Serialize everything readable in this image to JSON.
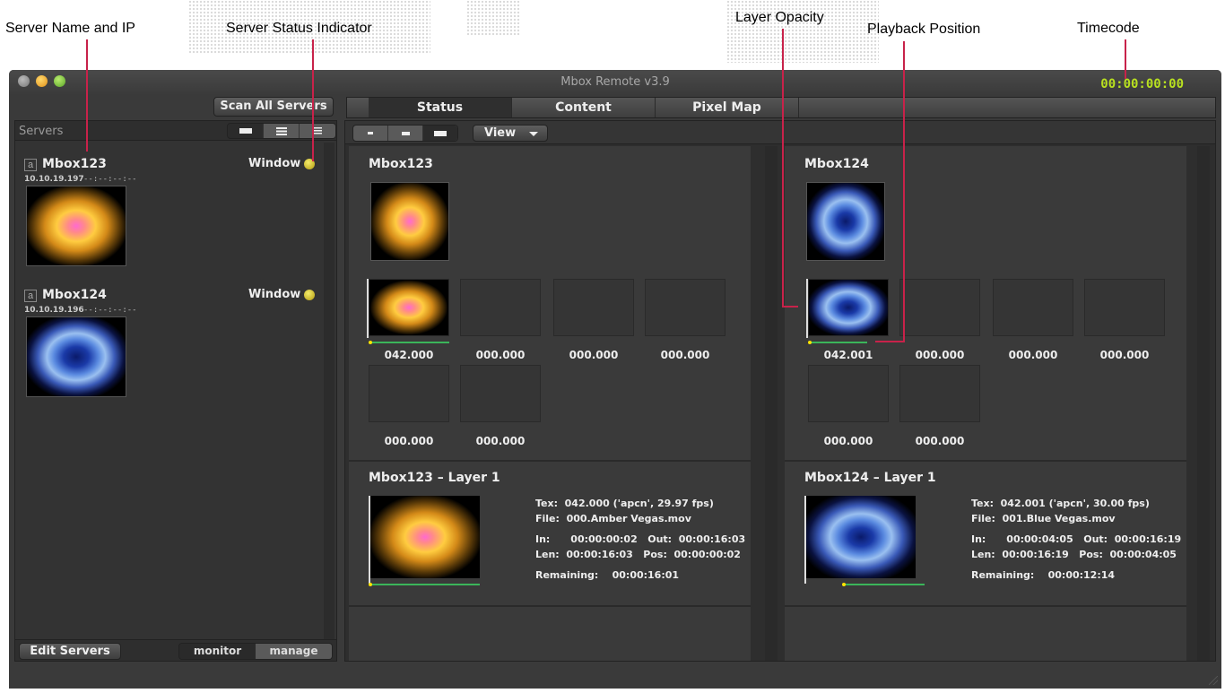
{
  "annotations": [
    {
      "text": "Server Name and IP"
    },
    {
      "text": "Server Status Indicator"
    },
    {
      "text": "Layer Opacity"
    },
    {
      "text": "Playback Position"
    },
    {
      "text": "Timecode"
    }
  ],
  "window": {
    "title": "Mbox Remote v3.9",
    "timecode": "00:00:00:00"
  },
  "sidebar": {
    "scan_label": "Scan All Servers",
    "header_label": "Servers",
    "servers": [
      {
        "name": "Mbox123",
        "ip": "10.10.19.197",
        "time": "--:--:--:--",
        "mode": "Window",
        "tag": "a"
      },
      {
        "name": "Mbox124",
        "ip": "10.10.19.196",
        "time": "--:--:--:--",
        "mode": "Window",
        "tag": "a"
      }
    ],
    "edit_label": "Edit Servers",
    "monitor_label": "monitor",
    "manage_label": "manage"
  },
  "tabs": [
    {
      "label": "Status",
      "active": true
    },
    {
      "label": "Content",
      "active": false
    },
    {
      "label": "Pixel Map",
      "active": false
    }
  ],
  "toolbar": {
    "view_label": "View"
  },
  "panes": [
    {
      "title": "Mbox123",
      "layers": [
        "042.000",
        "000.000",
        "000.000",
        "000.000",
        "000.000",
        "000.000"
      ],
      "detail_title": "Mbox123 – Layer 1",
      "tex": "Tex:  042.000 ('apcn', 29.97 fps)",
      "file": "File:  000.Amber Vegas.mov",
      "in_out": "In:      00:00:00:02   Out:  00:00:16:03",
      "len_pos": "Len:  00:00:16:03   Pos:  00:00:00:02",
      "remaining": "Remaining:    00:00:16:01"
    },
    {
      "title": "Mbox124",
      "layers": [
        "042.001",
        "000.000",
        "000.000",
        "000.000",
        "000.000",
        "000.000"
      ],
      "detail_title": "Mbox124 – Layer 1",
      "tex": "Tex:  042.001 ('apcn', 30.00 fps)",
      "file": "File:  001.Blue Vegas.mov",
      "in_out": "In:      00:00:04:05   Out:  00:00:16:19",
      "len_pos": "Len:  00:00:16:19   Pos:  00:00:04:05",
      "remaining": "Remaining:    00:00:12:14"
    }
  ],
  "colors": {
    "timecode": "#b8e020",
    "status_dot": "#d8c820",
    "leader": "#c8224a",
    "progress": "#3bb55a"
  }
}
